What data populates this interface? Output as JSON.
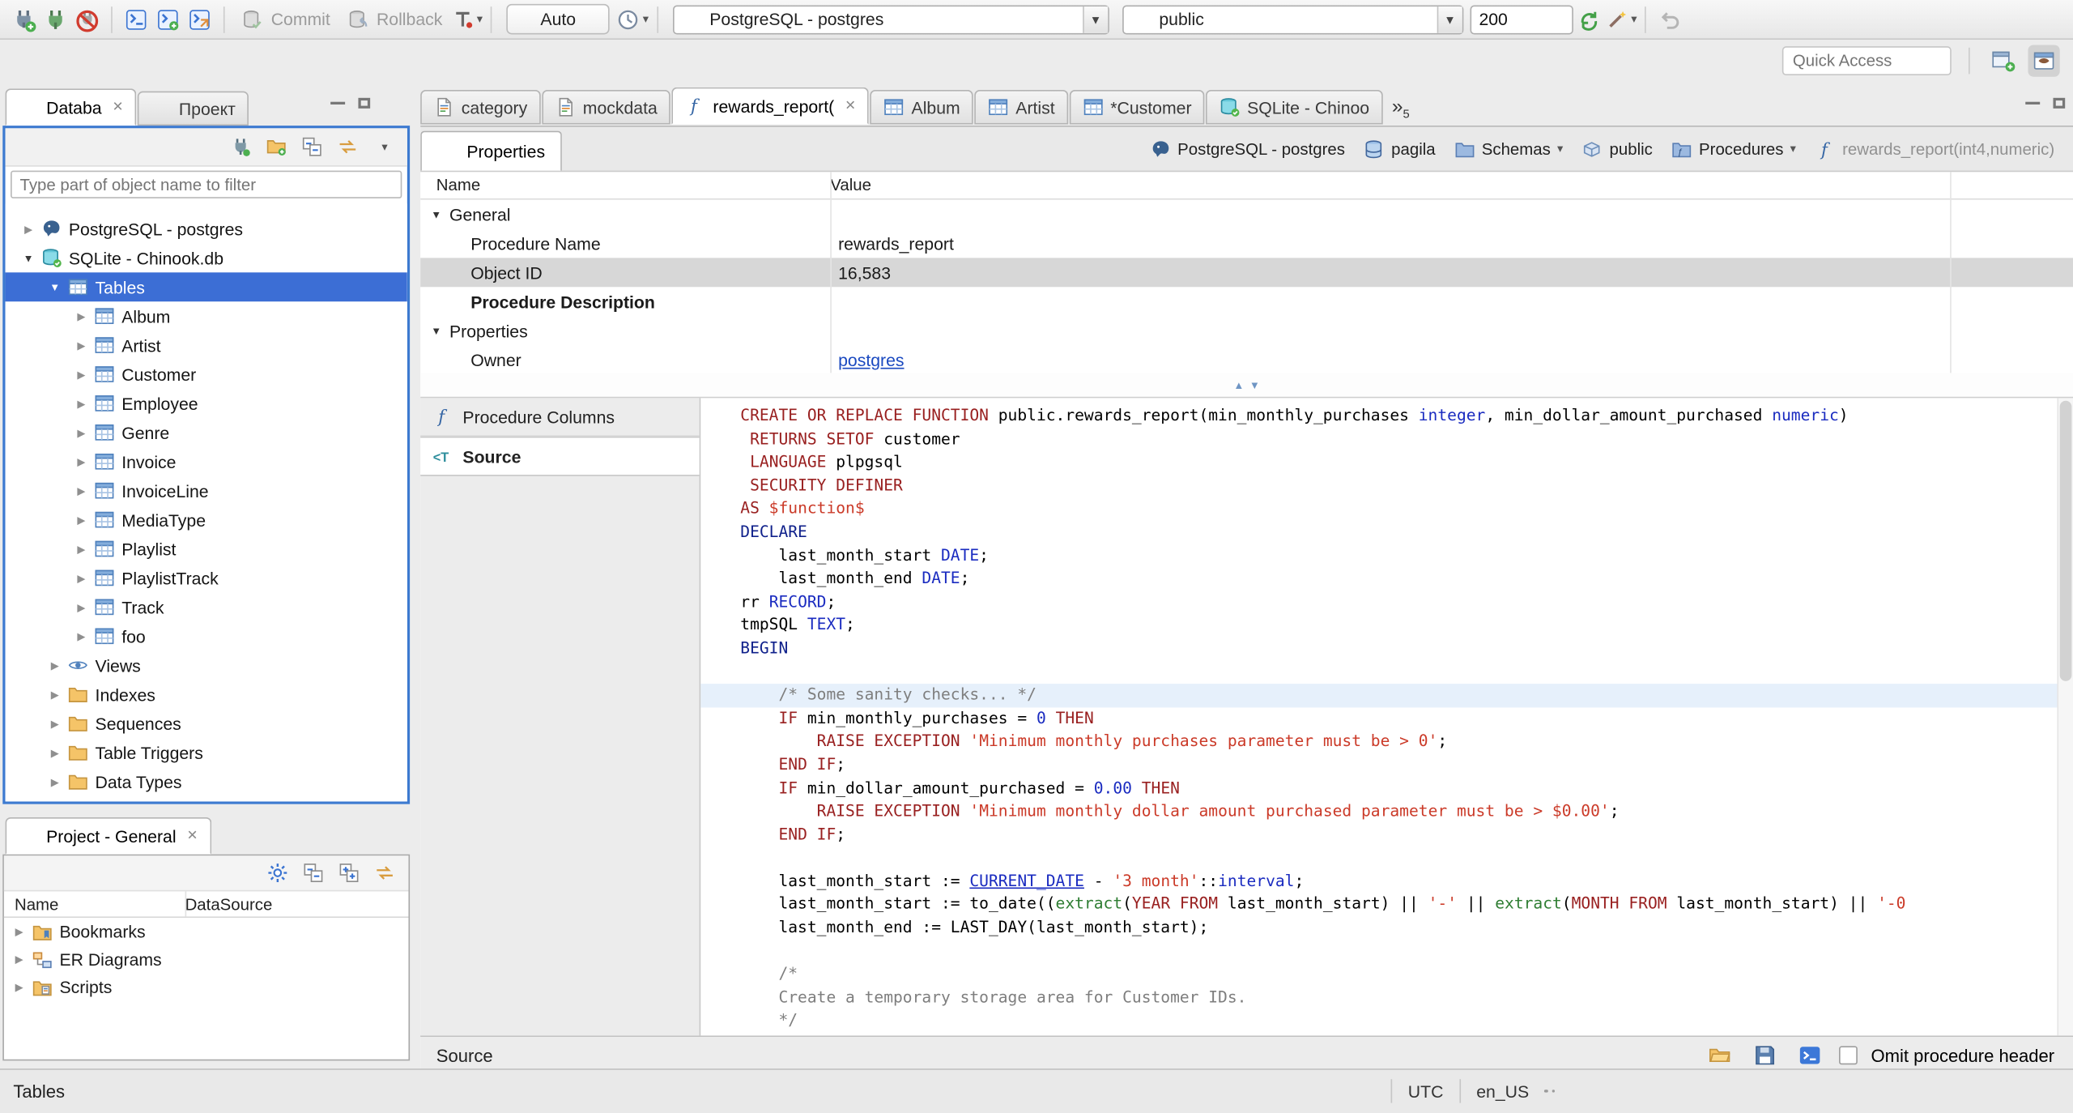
{
  "toolbar": {
    "commit_label": "Commit",
    "rollback_label": "Rollback",
    "auto_label": "Auto",
    "connection_combo": "PostgreSQL - postgres",
    "schema_combo": "public",
    "fetch_size_value": "200",
    "quick_access_placeholder": "Quick Access"
  },
  "left_tabs": {
    "database_tab": "Databa",
    "project_tab": "Проект"
  },
  "navigator": {
    "filter_placeholder": "Type part of object name to filter",
    "tree": [
      {
        "label": "PostgreSQL - postgres",
        "icon": "postgres-icon",
        "level": 0,
        "state": "collapsed"
      },
      {
        "label": "SQLite - Chinook.db",
        "icon": "sqlite-icon",
        "level": 0,
        "state": "expanded"
      },
      {
        "label": "Tables",
        "icon": "table-icon",
        "level": 1,
        "state": "expanded",
        "selected": true
      },
      {
        "label": "Album",
        "icon": "table-icon",
        "level": 2,
        "state": "collapsed"
      },
      {
        "label": "Artist",
        "icon": "table-icon",
        "level": 2,
        "state": "collapsed"
      },
      {
        "label": "Customer",
        "icon": "table-icon",
        "level": 2,
        "state": "collapsed"
      },
      {
        "label": "Employee",
        "icon": "table-icon",
        "level": 2,
        "state": "collapsed"
      },
      {
        "label": "Genre",
        "icon": "table-icon",
        "level": 2,
        "state": "collapsed"
      },
      {
        "label": "Invoice",
        "icon": "table-icon",
        "level": 2,
        "state": "collapsed"
      },
      {
        "label": "InvoiceLine",
        "icon": "table-icon",
        "level": 2,
        "state": "collapsed"
      },
      {
        "label": "MediaType",
        "icon": "table-icon",
        "level": 2,
        "state": "collapsed"
      },
      {
        "label": "Playlist",
        "icon": "table-icon",
        "level": 2,
        "state": "collapsed"
      },
      {
        "label": "PlaylistTrack",
        "icon": "table-icon",
        "level": 2,
        "state": "collapsed"
      },
      {
        "label": "Track",
        "icon": "table-icon",
        "level": 2,
        "state": "collapsed"
      },
      {
        "label": "foo",
        "icon": "table-icon",
        "level": 2,
        "state": "collapsed"
      },
      {
        "label": "Views",
        "icon": "views-icon",
        "level": 1,
        "state": "collapsed"
      },
      {
        "label": "Indexes",
        "icon": "folder-icon",
        "level": 1,
        "state": "collapsed"
      },
      {
        "label": "Sequences",
        "icon": "folder-icon",
        "level": 1,
        "state": "collapsed"
      },
      {
        "label": "Table Triggers",
        "icon": "folder-icon",
        "level": 1,
        "state": "collapsed"
      },
      {
        "label": "Data Types",
        "icon": "folder-icon",
        "level": 1,
        "state": "collapsed"
      }
    ]
  },
  "project_panel": {
    "title": "Project - General",
    "columns": [
      "Name",
      "DataSource"
    ],
    "rows": [
      {
        "label": "Bookmarks",
        "icon": "bookmarks-icon"
      },
      {
        "label": "ER Diagrams",
        "icon": "er-diagram-icon"
      },
      {
        "label": "Scripts",
        "icon": "scripts-icon"
      }
    ]
  },
  "editor_tabs": [
    {
      "label": "category",
      "icon": "script-icon"
    },
    {
      "label": "mockdata",
      "icon": "script-icon"
    },
    {
      "label": "rewards_report(",
      "icon": "function-icon",
      "active": true,
      "closable": true
    },
    {
      "label": "Album",
      "icon": "table-icon"
    },
    {
      "label": "Artist",
      "icon": "table-icon"
    },
    {
      "label": "*Customer",
      "icon": "table-icon"
    },
    {
      "label": "SQLite - Chinoo",
      "icon": "sqlite-icon"
    }
  ],
  "tab_overflow_count": "5",
  "object_editor": {
    "properties_tab": "Properties",
    "breadcrumb": [
      {
        "label": "PostgreSQL - postgres",
        "icon": "postgres-icon"
      },
      {
        "label": "pagila",
        "icon": "database-icon"
      },
      {
        "label": "Schemas",
        "icon": "schemas-icon",
        "dropdown": true
      },
      {
        "label": "public",
        "icon": "schema-icon"
      },
      {
        "label": "Procedures",
        "icon": "procedures-icon",
        "dropdown": true
      },
      {
        "label": "rewards_report(int4,numeric)",
        "icon": "function-icon",
        "muted": true
      }
    ],
    "grid_columns": [
      "Name",
      "Value"
    ],
    "grid_rows": [
      {
        "name": "General",
        "group": true
      },
      {
        "name": "Procedure Name",
        "value": "rewards_report"
      },
      {
        "name": "Object ID",
        "value": "16,583",
        "selected": true
      },
      {
        "name": "Procedure Description",
        "bold": true
      },
      {
        "name": "Properties",
        "group": true
      },
      {
        "name": "Owner",
        "value": "postgres",
        "link": true
      }
    ],
    "sections": [
      {
        "label": "Procedure Columns",
        "icon": "function-icon"
      },
      {
        "label": "Source",
        "icon": "source-icon",
        "active": true
      }
    ],
    "footer_label": "Source",
    "omit_checkbox_label": "Omit procedure header"
  },
  "current_line_index": 12,
  "code_lines": [
    [
      [
        "k",
        "CREATE OR REPLACE FUNCTION"
      ],
      [
        "p",
        " public.rewards_report(min_monthly_purchases "
      ],
      [
        "t",
        "integer"
      ],
      [
        "p",
        ", min_dollar_amount_purchased "
      ],
      [
        "t",
        "numeric"
      ],
      [
        "p",
        ")"
      ]
    ],
    [
      [
        "p",
        " "
      ],
      [
        "k",
        "RETURNS SETOF"
      ],
      [
        "p",
        " customer"
      ]
    ],
    [
      [
        "p",
        " "
      ],
      [
        "k",
        "LANGUAGE"
      ],
      [
        "p",
        " plpgsql"
      ]
    ],
    [
      [
        "p",
        " "
      ],
      [
        "k",
        "SECURITY DEFINER"
      ]
    ],
    [
      [
        "k",
        "AS"
      ],
      [
        "s",
        " $function$"
      ]
    ],
    [
      [
        "b",
        "DECLARE"
      ]
    ],
    [
      [
        "p",
        "    last_month_start "
      ],
      [
        "t",
        "DATE"
      ],
      [
        "p",
        ";"
      ]
    ],
    [
      [
        "p",
        "    last_month_end "
      ],
      [
        "t",
        "DATE"
      ],
      [
        "p",
        ";"
      ]
    ],
    [
      [
        "p",
        "rr "
      ],
      [
        "t",
        "RECORD"
      ],
      [
        "p",
        ";"
      ]
    ],
    [
      [
        "p",
        "tmpSQL "
      ],
      [
        "t",
        "TEXT"
      ],
      [
        "p",
        ";"
      ]
    ],
    [
      [
        "b",
        "BEGIN"
      ]
    ],
    [],
    [
      [
        "c",
        "    /* Some sanity checks... */"
      ]
    ],
    [
      [
        "p",
        "    "
      ],
      [
        "k",
        "IF"
      ],
      [
        "p",
        " min_monthly_purchases = "
      ],
      [
        "t",
        "0"
      ],
      [
        "p",
        " "
      ],
      [
        "k",
        "THEN"
      ]
    ],
    [
      [
        "p",
        "        "
      ],
      [
        "k",
        "RAISE EXCEPTION"
      ],
      [
        "p",
        " "
      ],
      [
        "s",
        "'Minimum monthly purchases parameter must be > 0'"
      ],
      [
        "p",
        ";"
      ]
    ],
    [
      [
        "p",
        "    "
      ],
      [
        "k",
        "END IF"
      ],
      [
        "p",
        ";"
      ]
    ],
    [
      [
        "p",
        "    "
      ],
      [
        "k",
        "IF"
      ],
      [
        "p",
        " min_dollar_amount_purchased = "
      ],
      [
        "t",
        "0.00"
      ],
      [
        "p",
        " "
      ],
      [
        "k",
        "THEN"
      ]
    ],
    [
      [
        "p",
        "        "
      ],
      [
        "k",
        "RAISE EXCEPTION"
      ],
      [
        "p",
        " "
      ],
      [
        "s",
        "'Minimum monthly dollar amount purchased parameter must be > $0.00'"
      ],
      [
        "p",
        ";"
      ]
    ],
    [
      [
        "p",
        "    "
      ],
      [
        "k",
        "END IF"
      ],
      [
        "p",
        ";"
      ]
    ],
    [],
    [
      [
        "p",
        "    last_month_start := "
      ],
      [
        "u",
        "CURRENT_DATE"
      ],
      [
        "p",
        " - "
      ],
      [
        "s",
        "'3 month'"
      ],
      [
        "p",
        "::"
      ],
      [
        "t",
        "interval"
      ],
      [
        "p",
        ";"
      ]
    ],
    [
      [
        "p",
        "    last_month_start := to_date(("
      ],
      [
        "f",
        "extract"
      ],
      [
        "p",
        "("
      ],
      [
        "k",
        "YEAR FROM"
      ],
      [
        "p",
        " last_month_start) || "
      ],
      [
        "s",
        "'-'"
      ],
      [
        "p",
        " || "
      ],
      [
        "f",
        "extract"
      ],
      [
        "p",
        "("
      ],
      [
        "k",
        "MONTH FROM"
      ],
      [
        "p",
        " last_month_start) || "
      ],
      [
        "s",
        "'-0"
      ]
    ],
    [
      [
        "p",
        "    last_month_end := LAST_DAY(last_month_start);"
      ]
    ],
    [],
    [
      [
        "c",
        "    /*"
      ]
    ],
    [
      [
        "c",
        "    Create a temporary storage area for Customer IDs."
      ]
    ],
    [
      [
        "c",
        "    */"
      ]
    ]
  ],
  "status_bar": {
    "left": "Tables",
    "timezone": "UTC",
    "locale": "en_US"
  }
}
